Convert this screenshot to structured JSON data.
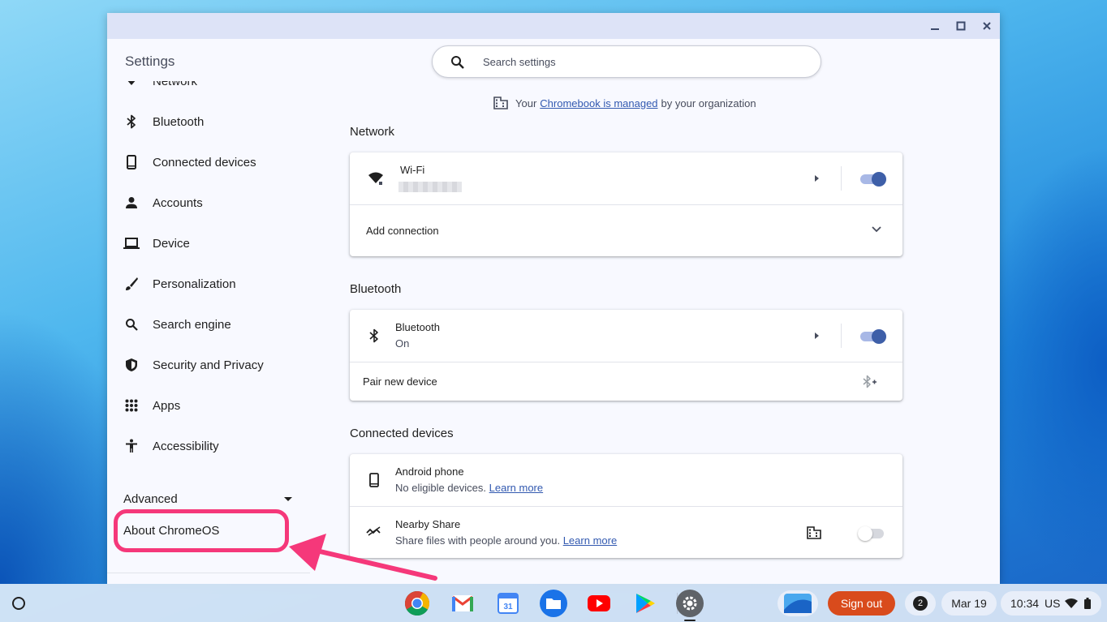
{
  "app": {
    "title": "Settings"
  },
  "window_controls": {
    "minimize": "minimize-icon",
    "maximize": "maximize-icon",
    "close": "close-icon"
  },
  "sidebar": {
    "partial_item": "Network",
    "items": [
      {
        "label": "Bluetooth",
        "icon": "bluetooth-icon"
      },
      {
        "label": "Connected devices",
        "icon": "phone-icon"
      },
      {
        "label": "Accounts",
        "icon": "person-icon"
      },
      {
        "label": "Device",
        "icon": "laptop-icon"
      },
      {
        "label": "Personalization",
        "icon": "brush-icon"
      },
      {
        "label": "Search engine",
        "icon": "search-icon"
      },
      {
        "label": "Security and Privacy",
        "icon": "shield-icon"
      },
      {
        "label": "Apps",
        "icon": "apps-grid-icon"
      },
      {
        "label": "Accessibility",
        "icon": "accessibility-icon"
      }
    ],
    "advanced": "Advanced",
    "about": "About ChromeOS"
  },
  "search": {
    "placeholder": "Search settings"
  },
  "managed_notice": {
    "prefix": "Your",
    "link": "Chromebook is managed",
    "suffix": "by your organization"
  },
  "sections": {
    "network": {
      "title": "Network",
      "wifi_title": "Wi-Fi",
      "wifi_enabled": true,
      "add_connection": "Add connection"
    },
    "bluetooth": {
      "title": "Bluetooth",
      "row_title": "Bluetooth",
      "row_status": "On",
      "enabled": true,
      "pair_new_device": "Pair new device"
    },
    "connected_devices": {
      "title": "Connected devices",
      "android_title": "Android phone",
      "android_sub": "No eligible devices.",
      "android_link": "Learn more",
      "nearby_title": "Nearby Share",
      "nearby_sub": "Share files with people around you.",
      "nearby_link": "Learn more",
      "nearby_enabled": false
    }
  },
  "shelf": {
    "apps": [
      "Chrome",
      "Gmail",
      "Calendar",
      "Files",
      "YouTube",
      "Play Store",
      "Settings"
    ],
    "sign_out": "Sign out",
    "notification_count": "2",
    "date": "Mar 19",
    "time": "10:34",
    "locale": "US"
  },
  "colors": {
    "accent": "#3e5fa8",
    "annotation": "#f5387a",
    "sign_out": "#d94b1c",
    "link": "#3259b0"
  }
}
